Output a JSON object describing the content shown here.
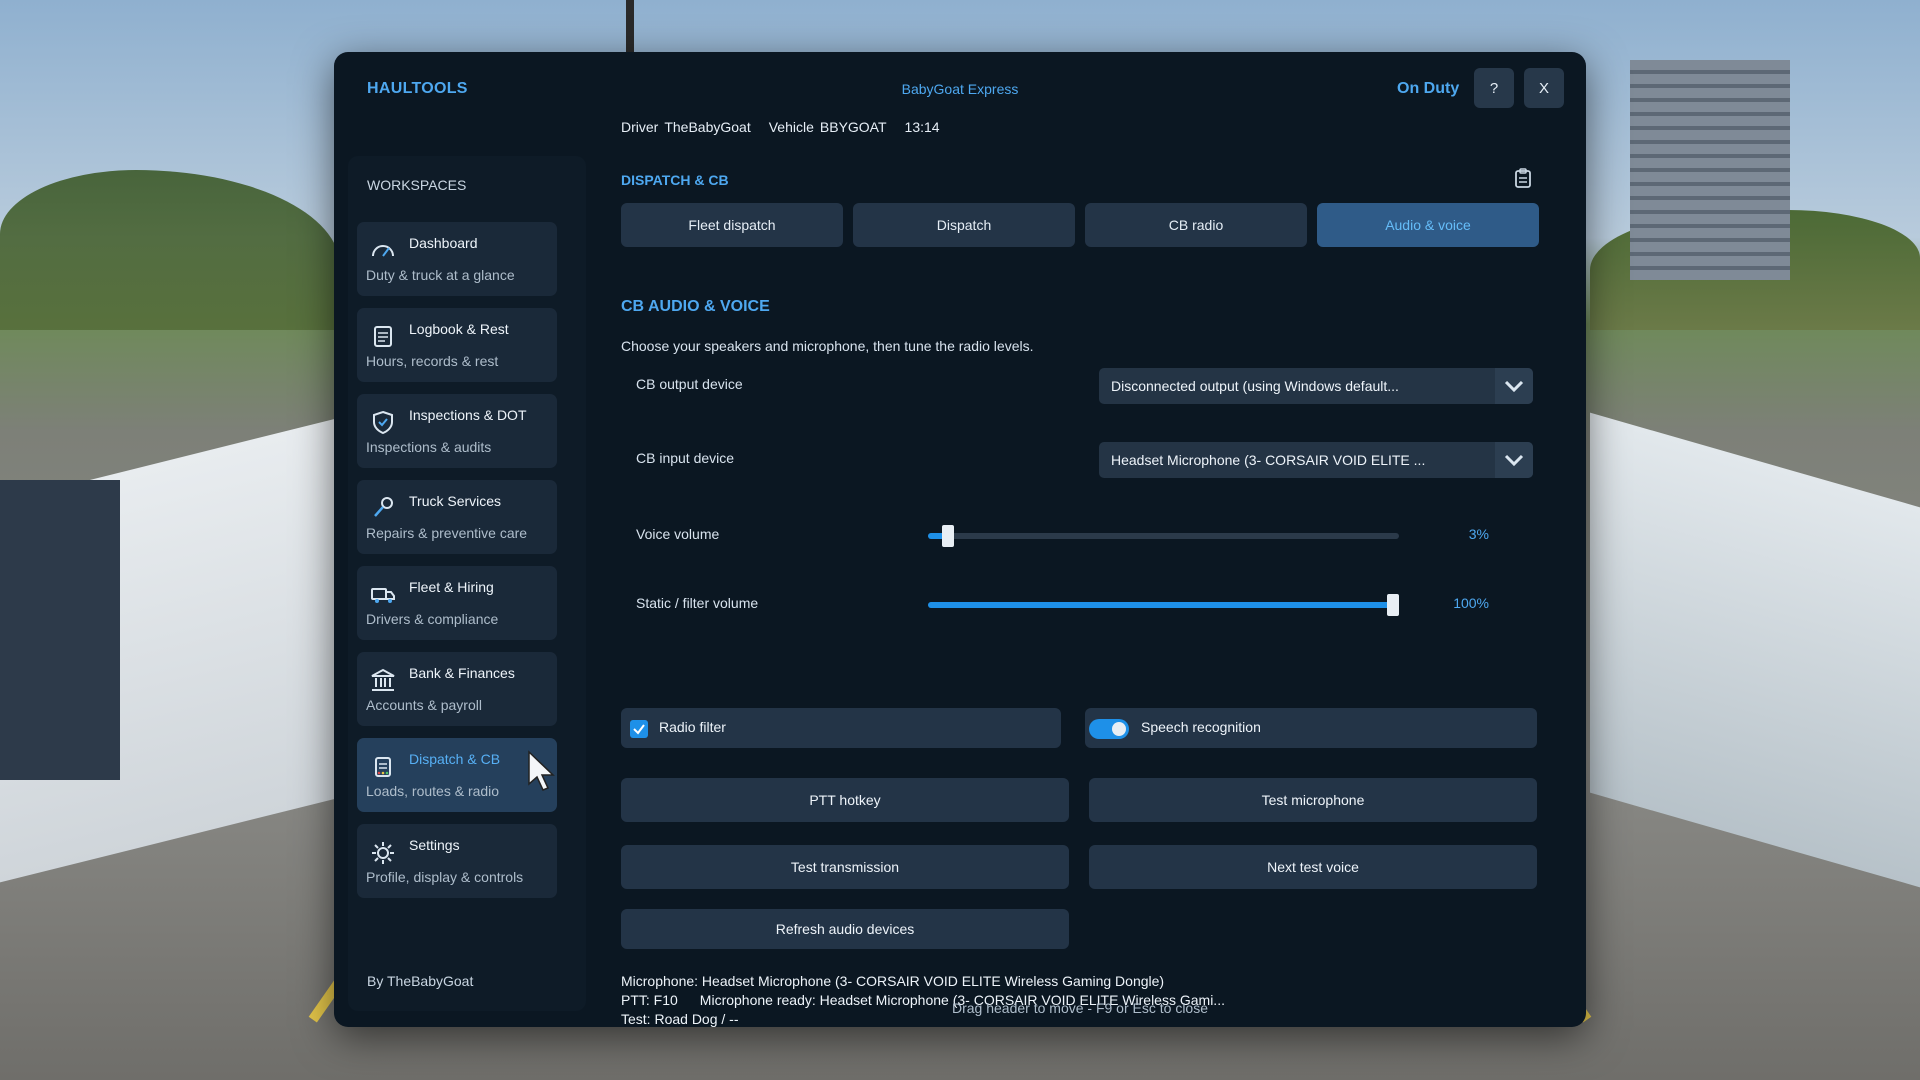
{
  "header": {
    "brand": "HAULTOOLS",
    "company": "BabyGoat Express",
    "duty_status": "On Duty",
    "help_label": "?",
    "close_label": "X",
    "driver_key": "Driver",
    "driver_value": "TheBabyGoat",
    "vehicle_key": "Vehicle",
    "vehicle_value": "BBYGOAT",
    "time": "13:14"
  },
  "sidebar": {
    "title": "WORKSPACES",
    "items": [
      {
        "label": "Dashboard",
        "sub": "Duty & truck at a glance",
        "icon": "gauge-icon"
      },
      {
        "label": "Logbook & Rest",
        "sub": "Hours, records & rest",
        "icon": "logbook-icon"
      },
      {
        "label": "Inspections & DOT",
        "sub": "Inspections & audits",
        "icon": "shield-check-icon"
      },
      {
        "label": "Truck Services",
        "sub": "Repairs & preventive care",
        "icon": "wrench-icon"
      },
      {
        "label": "Fleet & Hiring",
        "sub": "Drivers & compliance",
        "icon": "truck-icon"
      },
      {
        "label": "Bank & Finances",
        "sub": "Accounts & payroll",
        "icon": "bank-icon"
      },
      {
        "label": "Dispatch & CB",
        "sub": "Loads, routes & radio",
        "icon": "clipboard-icon",
        "active": true
      },
      {
        "label": "Settings",
        "sub": "Profile, display & controls",
        "icon": "gear-icon"
      }
    ],
    "byline": "By TheBabyGoat"
  },
  "main": {
    "section": "DISPATCH & CB",
    "tabs": [
      {
        "label": "Fleet dispatch"
      },
      {
        "label": "Dispatch"
      },
      {
        "label": "CB radio"
      },
      {
        "label": "Audio & voice",
        "active": true
      }
    ],
    "heading": "CB AUDIO & VOICE",
    "description": "Choose your speakers and microphone, then tune the radio levels.",
    "output_label": "CB output device",
    "output_value": "Disconnected output (using Windows default...",
    "input_label": "CB input device",
    "input_value": "Headset Microphone (3- CORSAIR VOID ELITE ...",
    "voice_label": "Voice volume",
    "voice_value": 3,
    "voice_pct": "3%",
    "static_label": "Static / filter volume",
    "static_value": 100,
    "static_pct": "100%",
    "radio_filter_label": "Radio filter",
    "radio_filter_checked": true,
    "speech_label": "Speech recognition",
    "speech_on": true,
    "actions": {
      "ptt": "PTT hotkey",
      "test_mic": "Test microphone",
      "test_tx": "Test transmission",
      "next_voice": "Next test voice",
      "refresh": "Refresh audio devices"
    },
    "status_line1": "Microphone: Headset Microphone (3- CORSAIR VOID ELITE Wireless Gaming Dongle)",
    "status_ptt": "PTT: F10",
    "status_ready": "Microphone ready: Headset Microphone (3- CORSAIR VOID ELITE Wireless Gami...",
    "status_line3": "Test: Road Dog / --"
  },
  "footer": "Drag header to move - F9 or Esc to close",
  "colors": {
    "accent": "#4ea8f0",
    "panel": "#0b1722",
    "button": "#233447",
    "active_tab": "#2f5b88",
    "slider_fill": "#1e90e8"
  }
}
